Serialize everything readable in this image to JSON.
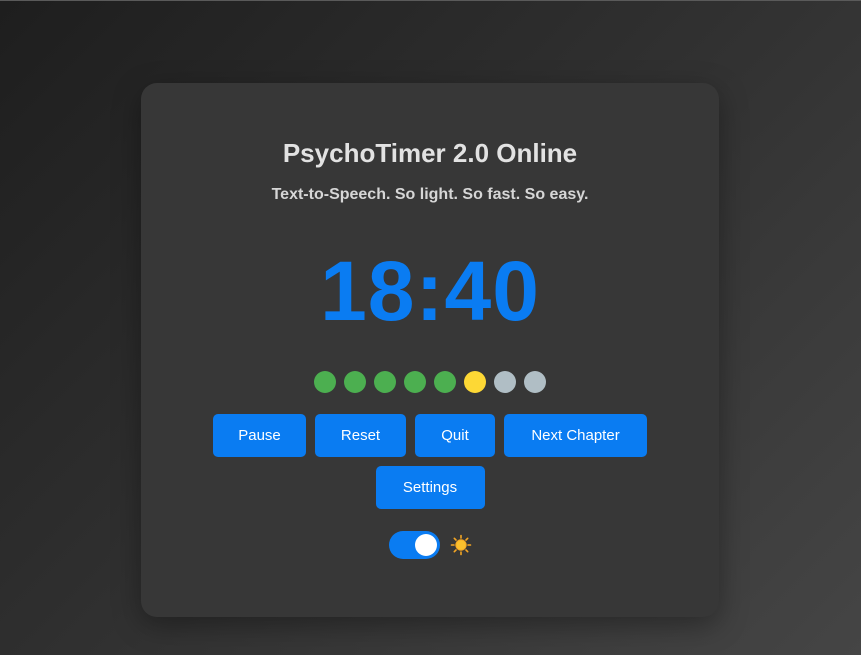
{
  "app": {
    "title": "PsychoTimer 2.0 Online",
    "subtitle": "Text-to-Speech. So light. So fast. So easy."
  },
  "timer": {
    "display": "18:40"
  },
  "progress": {
    "dots": [
      {
        "state": "complete",
        "color": "#4caf50"
      },
      {
        "state": "complete",
        "color": "#4caf50"
      },
      {
        "state": "complete",
        "color": "#4caf50"
      },
      {
        "state": "complete",
        "color": "#4caf50"
      },
      {
        "state": "complete",
        "color": "#4caf50"
      },
      {
        "state": "current",
        "color": "#fdd835"
      },
      {
        "state": "pending",
        "color": "#b0bec5"
      },
      {
        "state": "pending",
        "color": "#b0bec5"
      }
    ]
  },
  "controls": {
    "pause_label": "Pause",
    "reset_label": "Reset",
    "quit_label": "Quit",
    "next_chapter_label": "Next Chapter",
    "settings_label": "Settings"
  },
  "theme": {
    "toggle_on": true,
    "icon": "sun-icon"
  },
  "colors": {
    "accent": "#0a7cf2",
    "card": "#373737"
  }
}
